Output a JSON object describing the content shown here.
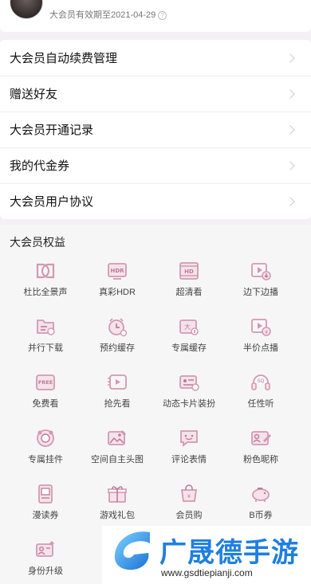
{
  "profile": {
    "expire_text": "大会员有效期至2021-04-29"
  },
  "menu": {
    "items": [
      {
        "label": "大会员自动续费管理"
      },
      {
        "label": "赠送好友"
      },
      {
        "label": "大会员开通记录"
      },
      {
        "label": "我的代金券"
      },
      {
        "label": "大会员用户协议"
      }
    ]
  },
  "benefits": {
    "title": "大会员权益",
    "items": [
      {
        "label": "杜比全景声",
        "icon": "dolby-icon"
      },
      {
        "label": "真彩HDR",
        "icon": "hdr-icon"
      },
      {
        "label": "超清看",
        "icon": "hd-icon"
      },
      {
        "label": "边下边播",
        "icon": "download-play-icon"
      },
      {
        "label": "并行下载",
        "icon": "parallel-download-icon"
      },
      {
        "label": "预约缓存",
        "icon": "reserve-cache-icon"
      },
      {
        "label": "专属缓存",
        "icon": "exclusive-cache-icon"
      },
      {
        "label": "半价点播",
        "icon": "half-price-icon"
      },
      {
        "label": "免费看",
        "icon": "free-icon"
      },
      {
        "label": "抢先看",
        "icon": "early-watch-icon"
      },
      {
        "label": "动态卡片装扮",
        "icon": "card-decor-icon"
      },
      {
        "label": "任性听",
        "icon": "headphones-icon"
      },
      {
        "label": "专属挂件",
        "icon": "pendant-icon"
      },
      {
        "label": "空间自主头图",
        "icon": "space-header-icon"
      },
      {
        "label": "评论表情",
        "icon": "emoji-icon"
      },
      {
        "label": "粉色昵称",
        "icon": "nickname-icon"
      },
      {
        "label": "漫读券",
        "icon": "comic-icon"
      },
      {
        "label": "游戏礼包",
        "icon": "gift-icon"
      },
      {
        "label": "会员购",
        "icon": "shop-icon"
      },
      {
        "label": "B币券",
        "icon": "piggy-bank-icon"
      },
      {
        "label": "身份升级",
        "icon": "identity-icon"
      }
    ]
  },
  "watermark": {
    "title": "广晟德手游",
    "url": "www.gsdtiepianji.com"
  },
  "colors": {
    "icon_pink": "#d9a4b8",
    "icon_pink_dark": "#c07a96",
    "watermark_blue": "#1f7fe0"
  }
}
